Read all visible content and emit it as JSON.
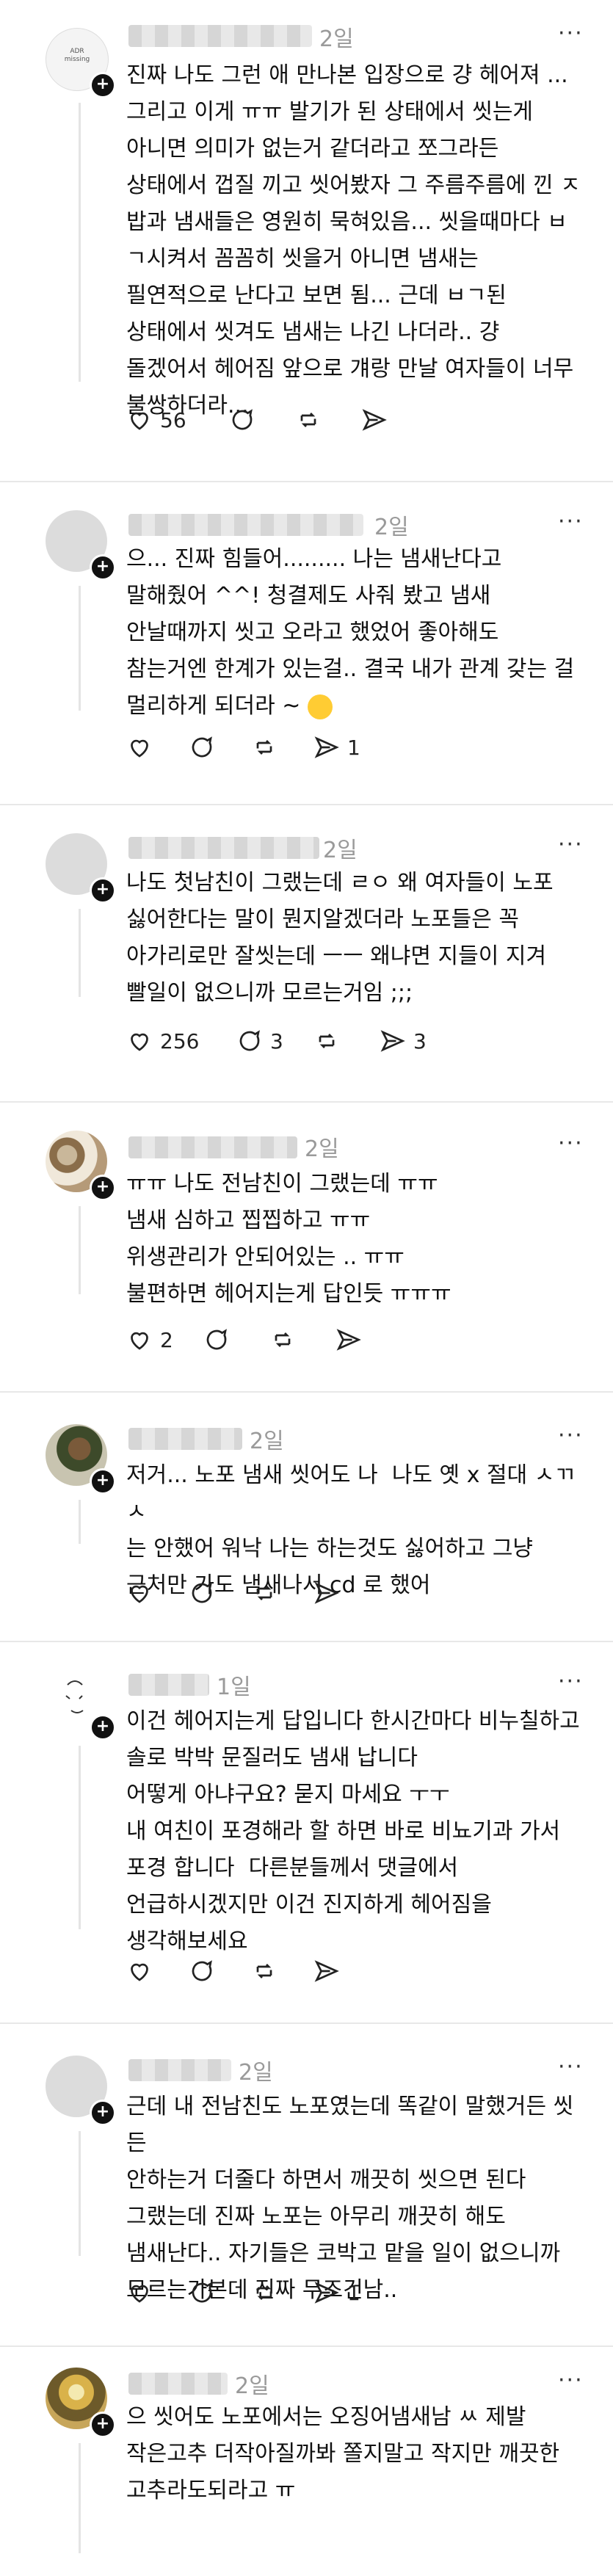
{
  "posts": [
    {
      "time": "2일",
      "text": "진짜 나도 그런 애 만나본 입장으로 걍 헤어져 ...\n그리고 이게 ㅠㅠ 발기가 된 상태에서 씻는게\n아니면 의미가 없는거 같더라고 쪼그라든\n상태에서 껍질 끼고 씻어봤자 그 주름주름에 낀 ㅈ\n밥과 냄새들은 영원히 묵혀있음... 씻을때마다 ㅂ\nㄱ시켜서 꼼꼼히 씻을거 아니면 냄새는\n필연적으로 난다고 보면 됨... 근데 ㅂㄱ된\n상태에서 씻겨도 냄새는 나긴 나더라.. 걍\n돌겠어서 헤어짐 앞으로 걔랑 만날 여자들이 너무\n불쌍하더라...",
      "likes": "56",
      "comments": "",
      "reposts": "",
      "shares": "",
      "avatar": "logo",
      "avatar_text": "ADR\nmissing"
    },
    {
      "time": "2일",
      "text": "으... 진짜 힘들어......... 나는 냄새난다고\n말해줬어 ^^! 청결제도 사줘 봤고 냄새\n안날때까지 씻고 오라고 했었어 좋아해도\n참는거엔 한계가 있는걸.. 결국 내가 관계 갖는 걸\n멀리하게 되더라 ~ ",
      "likes": "",
      "comments": "",
      "reposts": "",
      "shares": "1",
      "avatar": "grey"
    },
    {
      "time": "2일",
      "text": "나도 첫남친이 그랬는데 ㄹㅇ 왜 여자들이 노포\n싫어한다는 말이 뭔지알겠더라 노포들은 꼭\n아가리로만 잘씻는데 ㅡㅡ 왜냐면 지들이 지겨\n빨일이 없으니까 모르는거임 ;;;",
      "likes": "256",
      "comments": "3",
      "reposts": "",
      "shares": "3",
      "avatar": "grey"
    },
    {
      "time": "2일",
      "text": "ㅠㅠ 나도 전남친이 그랬는데 ㅠㅠ\n냄새 심하고 찝찝하고 ㅠㅠ\n위생관리가 안되어있는 .. ㅠㅠ\n불편하면 헤어지는게 답인듯 ㅠㅠㅠ",
      "likes": "2",
      "comments": "",
      "reposts": "",
      "shares": "",
      "avatar": "photo1"
    },
    {
      "time": "2일",
      "text": "저거... 노포 냄새 씻어도 나  나도 옛 x 절대 ㅅㄲㅅ\n는 안했어 워낙 나는 하는것도 싫어하고 그냥\n근처만 가도 냄새나서 cd 로 했어",
      "likes": "",
      "comments": "",
      "reposts": "",
      "shares": "",
      "avatar": "photo2"
    },
    {
      "time": "1일",
      "text": "이건 헤어지는게 답입니다 한시간마다 비누칠하고\n솔로 박박 문질러도 냄새 납니다\n어떻게 아냐구요? 묻지 마세요 ㅜㅜ\n내 여친이 포경해라 할 하면 바로 비뇨기과 가서\n포경 합니다  다른분들께서 댓글에서\n언급하시겠지만 이건 진지하게 헤어짐을\n생각해보세요",
      "likes": "",
      "comments": "",
      "reposts": "",
      "shares": "",
      "avatar": "sketch"
    },
    {
      "time": "2일",
      "text": "근데 내 전남친도 노포였는데 똑같이 말했거든 씻든\n안하는거 더줄다 하면서 깨끗히 씻으면 된다\n그랬는데 진짜 노포는 아무리 깨끗히 해도\n냄새난다.. 자기들은 코박고 맡을 일이 없으니까\n모르는가본데 진짜 무조건남..",
      "likes": "",
      "comments": "",
      "reposts": "",
      "shares": "1",
      "avatar": "grey"
    },
    {
      "time": "2일",
      "text": "으 씻어도 노포에서는 오징어냄새남 ㅆ 제발\n작은고추 더작아질까봐 쫄지말고 작지만 깨끗한\n고추라도되라고 ㅠ",
      "likes": "",
      "comments": "",
      "reposts": "",
      "shares": "",
      "avatar": "photo3"
    }
  ],
  "ui": {
    "more_label": "···",
    "icons": [
      "heart-icon",
      "comment-icon",
      "repost-icon",
      "share-icon"
    ]
  }
}
